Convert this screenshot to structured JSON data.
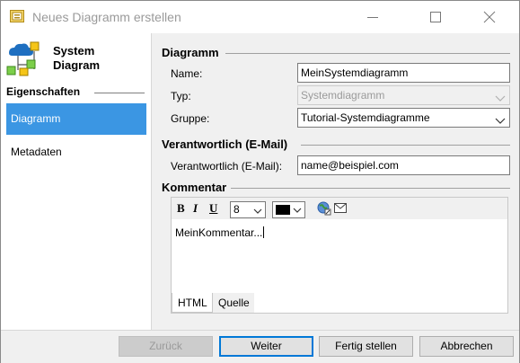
{
  "window": {
    "title": "Neues Diagramm erstellen"
  },
  "sidebar": {
    "logo_line1": "System",
    "logo_line2": "Diagram",
    "section": "Eigenschaften",
    "items": [
      {
        "label": "Diagramm",
        "active": true
      },
      {
        "label": "Metadaten",
        "active": false
      }
    ]
  },
  "diagramm": {
    "heading": "Diagramm",
    "name_label": "Name:",
    "name_value": "MeinSystemdiagramm",
    "typ_label": "Typ:",
    "typ_value": "Systemdiagramm",
    "gruppe_label": "Gruppe:",
    "gruppe_value": "Tutorial-Systemdiagramme"
  },
  "verantwortlich": {
    "heading": "Verantwortlich (E-Mail)",
    "label": "Verantwortlich (E-Mail):",
    "value": "name@beispiel.com"
  },
  "kommentar": {
    "heading": "Kommentar",
    "bold": "B",
    "italic": "I",
    "underline": "U",
    "font_size": "8",
    "text": "MeinKommentar...",
    "tabs": [
      {
        "label": "HTML",
        "active": true
      },
      {
        "label": "Quelle",
        "active": false
      }
    ]
  },
  "footer": {
    "back": "Zurück",
    "next": "Weiter",
    "finish": "Fertig stellen",
    "cancel": "Abbrechen"
  },
  "colors": {
    "accent": "#3b96e3",
    "default_button_border": "#0078d7",
    "text_color_swatch": "#000000"
  }
}
